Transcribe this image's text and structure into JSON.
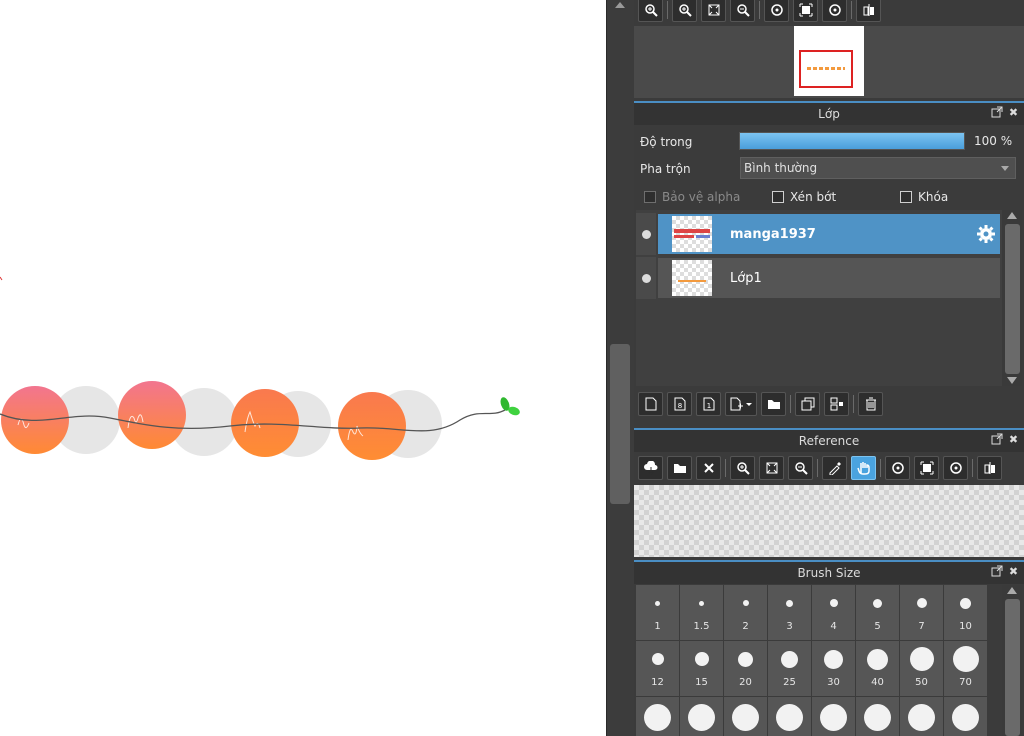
{
  "navigator": {
    "toolbar_icons": [
      "zoom-in-icon",
      "zoom-in-icon",
      "fit-window-icon",
      "zoom-out-icon",
      "rotate-left-icon",
      "fullscreen-icon",
      "rotate-right-icon",
      "flip-horizontal-icon"
    ]
  },
  "layer": {
    "title": "Lớp",
    "opacity_label": "Độ trong",
    "opacity_value": "100 %",
    "opacity_fraction": 1.0,
    "blend_label": "Pha trộn",
    "blend_value": "Bình thường",
    "protect_alpha": "Bảo vệ alpha",
    "clipping": "Xén bớt",
    "lock": "Khóa",
    "items": [
      {
        "name": "manga1937",
        "selected": true
      },
      {
        "name": "Lớp1",
        "selected": false
      }
    ],
    "toolbar_icons": [
      "new-layer-icon",
      "new-8bit-layer-icon",
      "new-1bit-layer-icon",
      "add-layer-menu-icon",
      "folder-icon",
      "duplicate-layer-icon",
      "merge-down-icon",
      "delete-layer-icon"
    ]
  },
  "reference": {
    "title": "Reference",
    "toolbar_icons": [
      "upload-icon",
      "open-folder-icon",
      "close-icon",
      "zoom-in-icon",
      "fit-window-icon",
      "zoom-out-icon",
      "eyedropper-icon",
      "hand-icon",
      "rotate-left-icon",
      "fullscreen-icon",
      "rotate-right-icon",
      "flip-horizontal-icon"
    ]
  },
  "brush_size": {
    "title": "Brush Size",
    "sizes": [
      "1",
      "1.5",
      "2",
      "3",
      "4",
      "5",
      "7",
      "10",
      "12",
      "15",
      "20",
      "25",
      "30",
      "40",
      "50",
      "70"
    ],
    "third_row_count": 8
  },
  "colors": {
    "accent": "#4f93c6",
    "panel_bg": "#3b3b3b",
    "circle_orange": "#ff8a33",
    "circle_pink": "#f07a8e",
    "shadow_gray": "#e6e6e6",
    "leaf_green": "#33cc33"
  }
}
